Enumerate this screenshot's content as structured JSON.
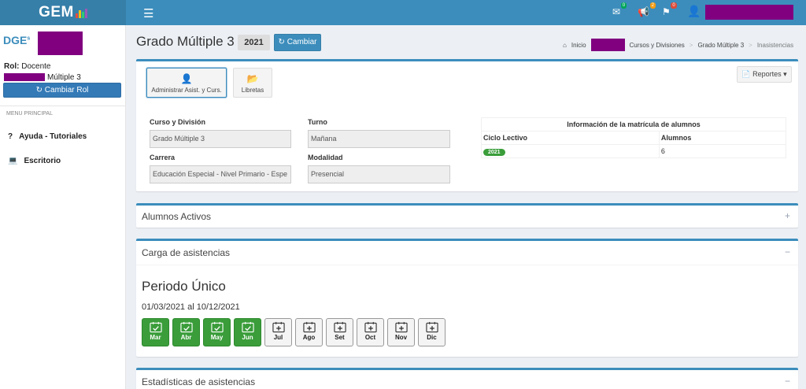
{
  "app": {
    "logo": "GEM",
    "logo_bar_colors": [
      "#e74c3c",
      "#f1c40f",
      "#2ecc71",
      "#9b59b6"
    ]
  },
  "topbar": {
    "menu_icon": "hamburger-icon",
    "notifications": [
      {
        "icon": "envelope-icon",
        "count": "0",
        "color": "#00a65a"
      },
      {
        "icon": "bullhorn-icon",
        "count": "2",
        "color": "#f39c12"
      },
      {
        "icon": "flag-icon",
        "count": "0",
        "color": "#dd4b39"
      }
    ]
  },
  "sidebar": {
    "logo_text": "DGE",
    "role_label": "Rol:",
    "role_value": "Docente",
    "role_course": "Múltiple 3",
    "change_role_label": "Cambiar Rol",
    "menu_header": "MENU PRINCIPAL",
    "items": [
      {
        "label": "Ayuda - Tutoriales",
        "icon": "question-icon"
      },
      {
        "label": "Escritorio",
        "icon": "laptop-icon"
      }
    ]
  },
  "header": {
    "title": "Grado Múltiple 3 -",
    "year": "2021",
    "change_label": "Cambiar",
    "breadcrumb": [
      "Inicio",
      "Cursos y Divisiones",
      "Grado Múltiple 3",
      "Inasistencias"
    ]
  },
  "top_box": {
    "tiles": [
      {
        "label": "Administrar Asist. y Curs.",
        "icon": "user-card-icon",
        "active": true
      },
      {
        "label": "Libretas",
        "icon": "folder-open-icon",
        "active": false
      }
    ],
    "reports_label": "Reportes",
    "fields": {
      "curso_label": "Curso y División",
      "curso_value": "Grado Múltiple 3",
      "turno_label": "Turno",
      "turno_value": "Mañana",
      "carrera_label": "Carrera",
      "carrera_value": "Educación Especial - Nivel Primario - Espe",
      "modalidad_label": "Modalidad",
      "modalidad_value": "Presencial"
    },
    "matricula": {
      "caption": "Información de la matrícula de alumnos",
      "headers": [
        "Ciclo Lectivo",
        "Alumnos"
      ],
      "rows": [
        {
          "ciclo": "2021",
          "alumnos": "6"
        }
      ]
    }
  },
  "alumnos_box": {
    "title": "Alumnos Activos",
    "tool": "+"
  },
  "carga_box": {
    "title": "Carga de asistencias",
    "tool": "−",
    "period_title": "Periodo Único",
    "period_dates": "01/03/2021 al 10/12/2021",
    "months": [
      {
        "label": "Mar",
        "done": true
      },
      {
        "label": "Abr",
        "done": true
      },
      {
        "label": "May",
        "done": true
      },
      {
        "label": "Jun",
        "done": true
      },
      {
        "label": "Jul",
        "done": false
      },
      {
        "label": "Ago",
        "done": false
      },
      {
        "label": "Set",
        "done": false
      },
      {
        "label": "Oct",
        "done": false
      },
      {
        "label": "Nov",
        "done": false
      },
      {
        "label": "Dic",
        "done": false
      }
    ]
  },
  "estadisticas_box": {
    "title": "Estadísticas de asistencias",
    "tool": "−"
  }
}
